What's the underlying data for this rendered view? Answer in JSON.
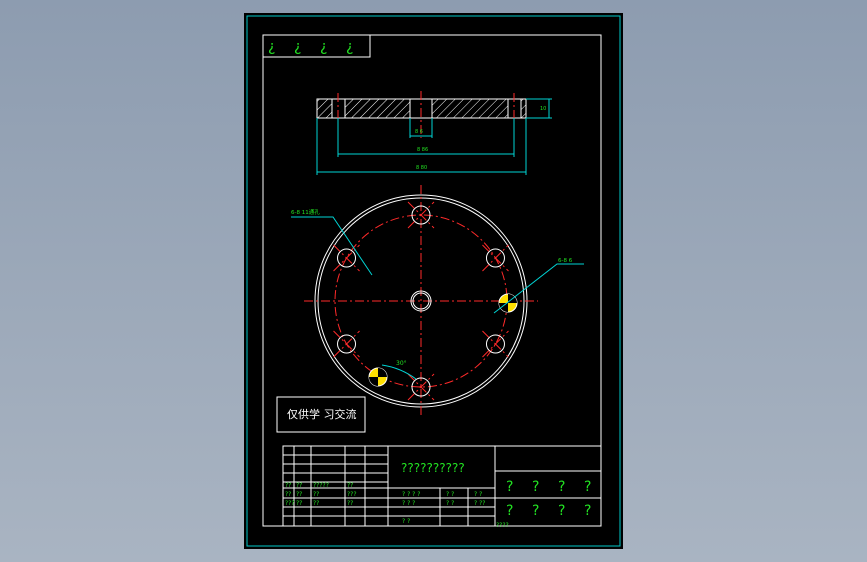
{
  "drawing": {
    "corner_tag_glyphs": [
      "¿",
      "¿",
      "¿",
      "¿"
    ],
    "section_view": {
      "dim_center_label": "8 6",
      "dim_middle_label": "8 86",
      "dim_outer_label": "8 80",
      "dim_thickness_label": "10"
    },
    "plan_view": {
      "hole_count": 6,
      "hole_callout_left": "6-8 11通孔",
      "hole_callout_right": "6-8 6",
      "angle_label": "30°"
    },
    "notice_text": "仅供学 习交流",
    "title_block": {
      "drawing_name": "??????????",
      "left_labels": [
        "??",
        "??",
        "?????",
        "??",
        "??",
        "??",
        "??",
        "???",
        "???",
        "??",
        "??",
        "??"
      ],
      "center_labels": [
        "? ? ? ?",
        "? ?",
        "? ?",
        "? ? ?",
        "? ?",
        "? ??",
        "? ?"
      ],
      "right_glyphs": [
        "?",
        "?",
        "?",
        "?",
        "?",
        "?",
        "?",
        "?"
      ],
      "bottom_note": "????"
    }
  },
  "colors": {
    "background": "#000000",
    "outline": "#ffffff",
    "centerline": "#ff2a2a",
    "dimension": "#00d4d4",
    "text": "#22e022",
    "marker_fill": "#ffe000"
  }
}
